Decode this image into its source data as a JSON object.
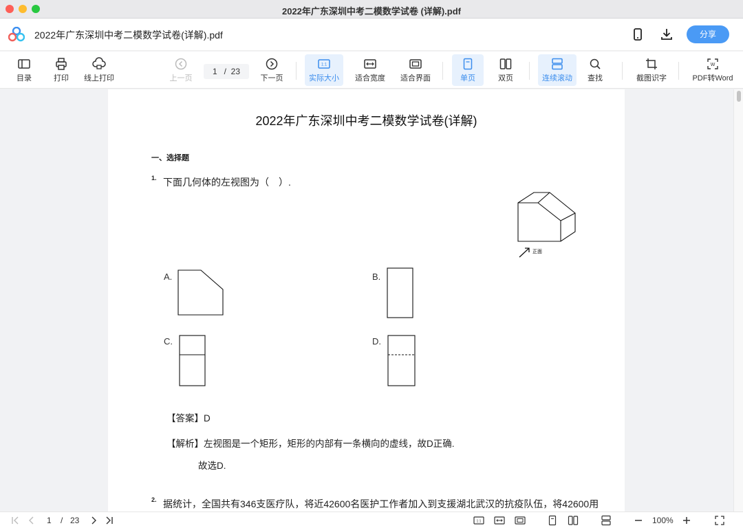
{
  "window": {
    "title": "2022年广东深圳中考二模数学试卷 (详解).pdf"
  },
  "header": {
    "doc_title": "2022年广东深圳中考二模数学试卷(详解).pdf",
    "share_label": "分享"
  },
  "toolbar": {
    "toc": "目录",
    "print": "打印",
    "online_print": "线上打印",
    "prev_page": "上一页",
    "current_page": "1",
    "page_separator": "/",
    "total_pages": "23",
    "next_page": "下一页",
    "actual_size": "实际大小",
    "actual_size_icon_text": "1:1",
    "fit_width": "适合宽度",
    "fit_page": "适合界面",
    "single_page": "单页",
    "double_page": "双页",
    "continuous_scroll": "连续滚动",
    "find": "查找",
    "screenshot_ocr": "截图识字",
    "pdf_to_word": "PDF转Word"
  },
  "document": {
    "title": "2022年广东深圳中考二模数学试卷(详解)",
    "section": "一、选择题",
    "questions": [
      {
        "number": "1.",
        "text": "下面几何体的左视图为（　）.",
        "figure_label": "正面",
        "options": [
          "A.",
          "B.",
          "C.",
          "D."
        ],
        "answer": "【答案】D",
        "analysis": "【解析】左视图是一个矩形，矩形的内部有一条横向的虚线，故D正确.",
        "conclusion": "故选D."
      },
      {
        "number": "2.",
        "text": "据统计，全国共有346支医疗队，将近42600名医护工作者加入到支援湖北武汉的抗疫队伍，将42600用"
      }
    ]
  },
  "bottombar": {
    "current_page": "1",
    "page_separator": "/",
    "total_pages": "23",
    "actual_size_icon_text": "1:1",
    "zoom": "100%"
  },
  "colors": {
    "accent": "#4a9af5",
    "active_bg": "#e7f1fd",
    "active_text": "#3b8ded"
  }
}
